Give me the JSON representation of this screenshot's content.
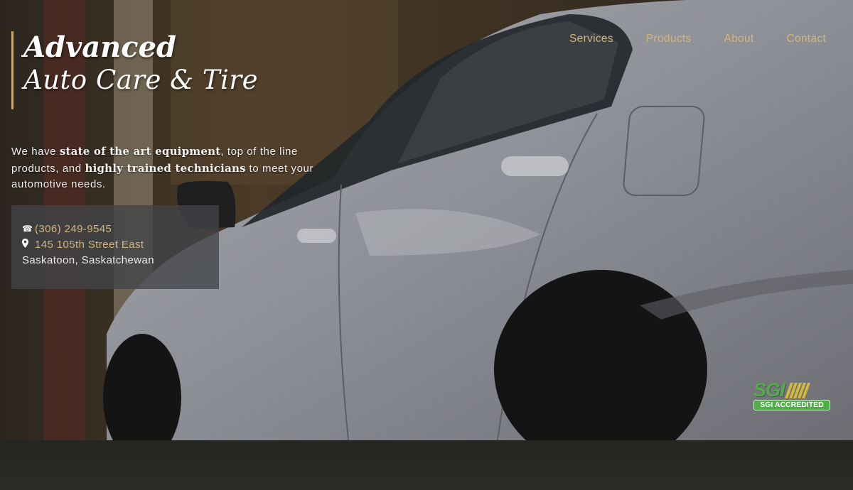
{
  "brand": {
    "line1": "Advanced",
    "line2": "Auto Care & Tire",
    "accent_color": "#c9a96e"
  },
  "nav": {
    "items": [
      {
        "label": "Services"
      },
      {
        "label": "Products"
      },
      {
        "label": "About"
      },
      {
        "label": "Contact"
      }
    ],
    "link_color": "#d2b57f"
  },
  "tagline": {
    "part1": "We have ",
    "bold1": "state of the art equipment",
    "part2": ", top of the line products, and ",
    "bold2": "highly trained technicians",
    "part3": " to meet your automotive needs."
  },
  "contact": {
    "phone": "(306) 249-9545",
    "phone_icon": "phone-icon",
    "address": "145 105th Street East",
    "address_icon": "map-marker-icon",
    "city": "Saskatoon, Saskatchewan"
  },
  "badge": {
    "logo_text": "SGI",
    "label": "SGI ACCREDITED",
    "brand_color": "#4fae48",
    "stripe_color": "#d8b83a"
  }
}
